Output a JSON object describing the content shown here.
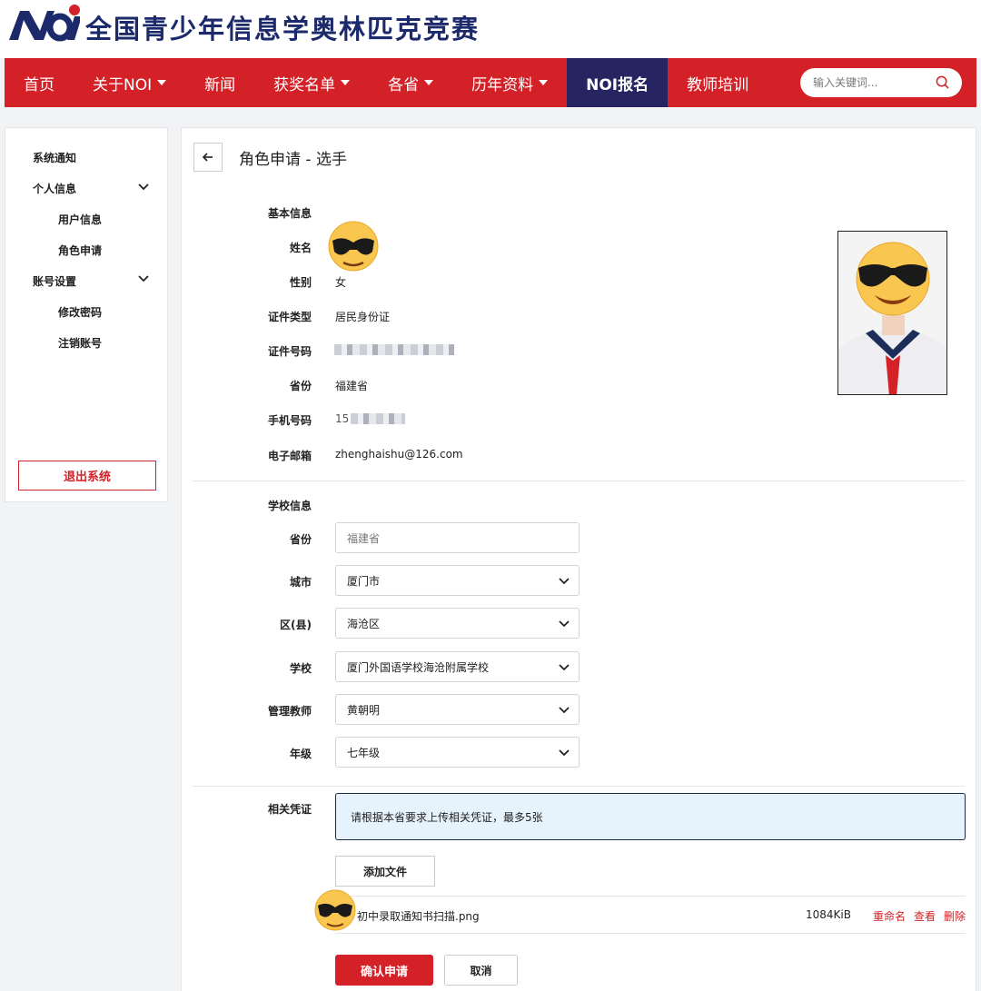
{
  "header": {
    "logo_text": "NOI",
    "site_title": "全国青少年信息学奥林匹克竞赛",
    "brand_color": "#d42027",
    "brand_dark": "#262561"
  },
  "nav": {
    "items": [
      {
        "label": "首页",
        "dropdown": false
      },
      {
        "label": "关于NOI",
        "dropdown": true
      },
      {
        "label": "新闻",
        "dropdown": false
      },
      {
        "label": "获奖名单",
        "dropdown": true
      },
      {
        "label": "各省",
        "dropdown": true
      },
      {
        "label": "历年资料",
        "dropdown": true
      },
      {
        "label": "NOI报名",
        "dropdown": false,
        "active": true
      },
      {
        "label": "教师培训",
        "dropdown": false
      }
    ],
    "search_placeholder": "输入关键词..."
  },
  "sidebar": {
    "system_notice": "系统通知",
    "personal_info": "个人信息",
    "user_info": "用户信息",
    "role_apply": "角色申请",
    "account_settings": "账号设置",
    "change_password": "修改密码",
    "delete_account": "注销账号",
    "logout": "退出系统"
  },
  "page": {
    "title": "角色申请 - 选手"
  },
  "basic_info": {
    "section_label": "基本信息",
    "name_label": "姓名",
    "name_value": "",
    "gender_label": "性别",
    "gender_value": "女",
    "id_type_label": "证件类型",
    "id_type_value": "居民身份证",
    "id_number_label": "证件号码",
    "province_label": "省份",
    "province_value": "福建省",
    "phone_label": "手机号码",
    "phone_prefix": "15",
    "email_label": "电子邮箱",
    "email_value": "zhenghaishu@126.com"
  },
  "school_info": {
    "section_label": "学校信息",
    "province_label": "省份",
    "province_value": "福建省",
    "city_label": "城市",
    "city_value": "厦门市",
    "district_label": "区(县)",
    "district_value": "海沧区",
    "school_label": "学校",
    "school_value": "厦门外国语学校海沧附属学校",
    "teacher_label": "管理教师",
    "teacher_value": "黄朝明",
    "grade_label": "年级",
    "grade_value": "七年级"
  },
  "credentials": {
    "section_label": "相关凭证",
    "notice": "请根据本省要求上传相关凭证，最多5张",
    "add_file": "添加文件",
    "files": [
      {
        "name": "初中录取通知书扫描.png",
        "size": "1084KiB",
        "rename": "重命名",
        "view": "查看",
        "delete": "删除"
      }
    ]
  },
  "actions": {
    "confirm": "确认申请",
    "cancel": "取消"
  }
}
